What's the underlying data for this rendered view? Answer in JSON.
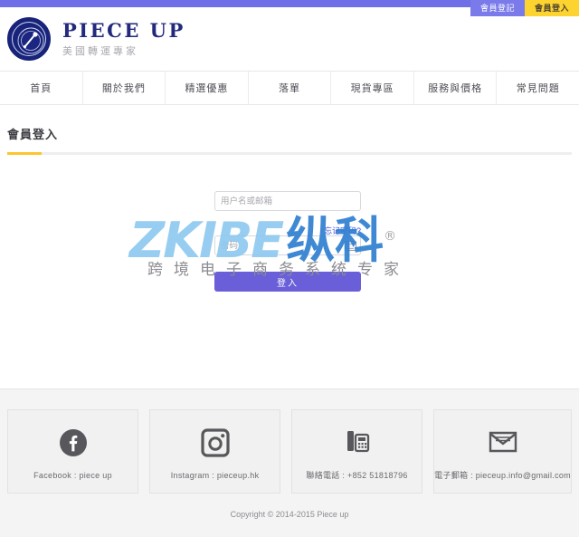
{
  "topbar": {
    "color": "#6f6fe8",
    "tabs": [
      {
        "label": "會員登記",
        "name": "register",
        "bg": "#7a7aea"
      },
      {
        "label": "會員登入",
        "name": "login",
        "bg": "#fdd330"
      }
    ]
  },
  "brand": {
    "logo_alt": "piece-up-logo",
    "name": "PIECE UP",
    "subtitle": "美國轉運專家",
    "color": "#232a7d"
  },
  "nav": {
    "items": [
      {
        "label": "首頁"
      },
      {
        "label": "關於我們"
      },
      {
        "label": "精選優惠"
      },
      {
        "label": "落單"
      },
      {
        "label": "現貨專區"
      },
      {
        "label": "服務與價格"
      },
      {
        "label": "常見問題"
      }
    ]
  },
  "page": {
    "title": "會員登入",
    "accent_color": "#fdc52e"
  },
  "login_form": {
    "username": {
      "value": "",
      "placeholder": "用户名或邮箱"
    },
    "password": {
      "value": "",
      "placeholder": "密码"
    },
    "forgot_label": "忘记密码?",
    "forgot_color": "#3d51d8",
    "submit_label": "登入",
    "submit_color": "#6a5fd8",
    "keyboard_icon": "keyboard-icon"
  },
  "watermark": {
    "logo_latin": "ZKIBE",
    "logo_cn": "纵科",
    "registered": "®",
    "tagline": "跨境电子商务系统专家",
    "color": "#8ec9ef"
  },
  "footer": {
    "cards": [
      {
        "icon": "facebook-icon",
        "label": "Facebook : piece up"
      },
      {
        "icon": "instagram-icon",
        "label": "Instagram : pieceup.hk"
      },
      {
        "icon": "telephone-icon",
        "label": "聯絡電話 : +852 51818796"
      },
      {
        "icon": "email-icon",
        "label": "電子郵箱 : pieceup.info@gmail.com"
      }
    ],
    "copyright": "Copyright © 2014-2015 Piece up"
  }
}
